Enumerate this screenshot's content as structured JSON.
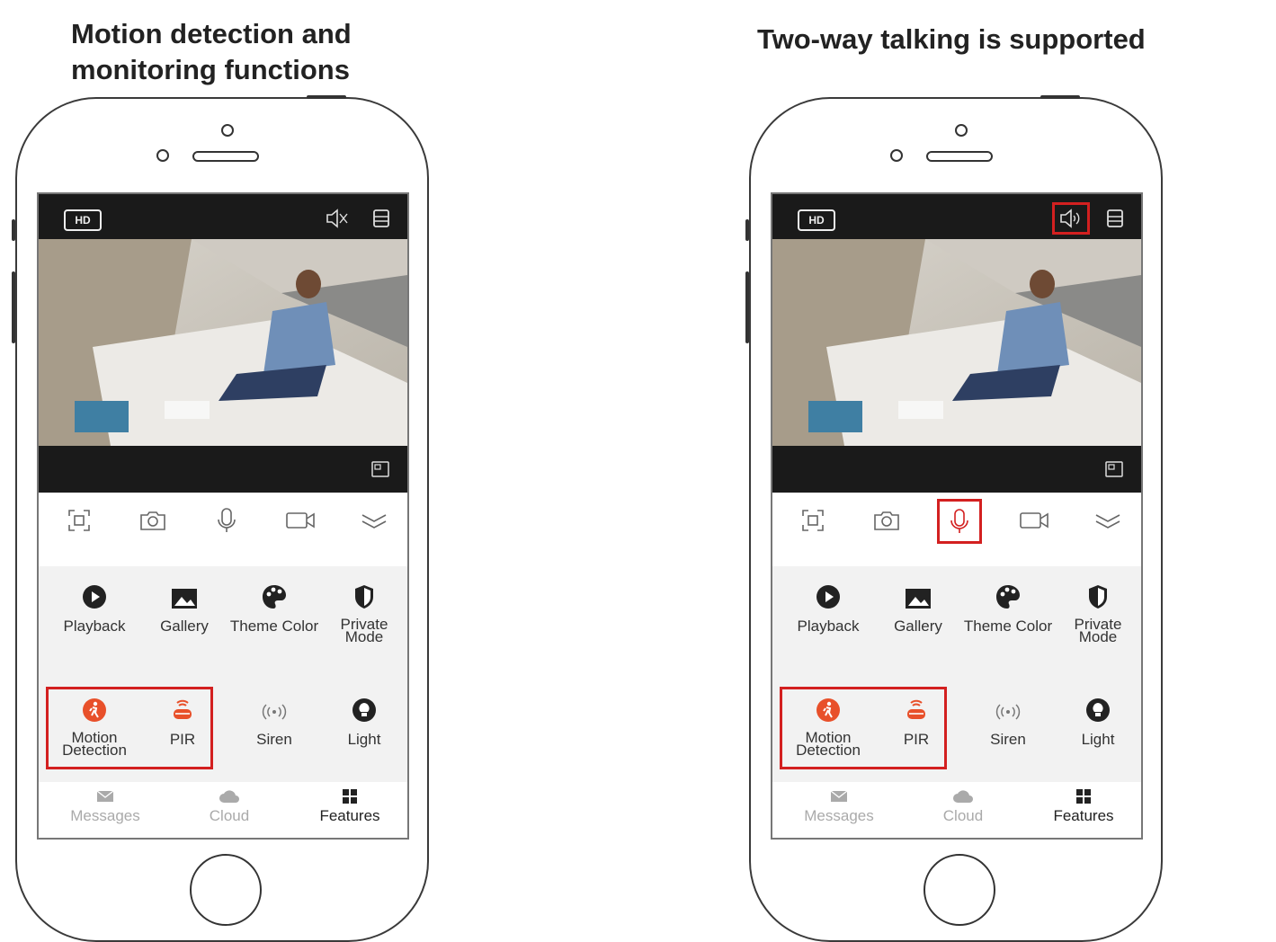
{
  "captions": {
    "left": "Motion detection and monitoring functions",
    "right": "Two-way talking is supported"
  },
  "app": {
    "hd_label": "HD",
    "features": [
      {
        "label": "Playback",
        "icon": "play-icon"
      },
      {
        "label": "Gallery",
        "icon": "gallery-icon"
      },
      {
        "label": "Theme Color",
        "icon": "palette-icon"
      },
      {
        "label": "Private Mode",
        "icon": "shield-icon"
      },
      {
        "label": "Motion Detection",
        "icon": "motion-icon"
      },
      {
        "label": "PIR",
        "icon": "pir-icon"
      },
      {
        "label": "Siren",
        "icon": "siren-icon"
      },
      {
        "label": "Light",
        "icon": "light-icon"
      }
    ],
    "tabs": [
      {
        "label": "Messages",
        "icon": "mail-icon"
      },
      {
        "label": "Cloud",
        "icon": "cloud-icon"
      },
      {
        "label": "Features",
        "icon": "features-icon"
      }
    ],
    "toolbar_icons": [
      "screenshot-icon",
      "camera-icon",
      "microphone-icon",
      "video-record-icon",
      "chevron-down-icon"
    ]
  },
  "colors": {
    "highlight": "#d32020",
    "accent_orange": "#e8502a",
    "dark_bar": "#1a1a1a"
  }
}
